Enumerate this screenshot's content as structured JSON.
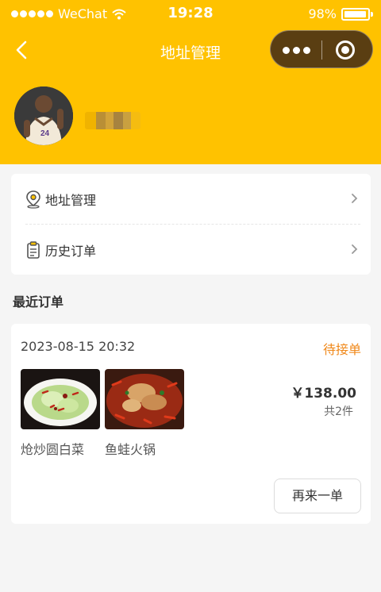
{
  "status_bar": {
    "carrier": "WeChat",
    "time": "19:28",
    "battery_percent": "98%",
    "battery_level": 0.98
  },
  "nav": {
    "title": "地址管理",
    "back_icon": "chevron-left-icon",
    "capsule_more_icon": "more-dots-icon",
    "capsule_close_icon": "target-close-icon"
  },
  "colors": {
    "header_bg": "#ffc200",
    "status_accent": "#f0881a",
    "page_bg": "#f5f5f5"
  },
  "menu": {
    "items": [
      {
        "label": "地址管理",
        "icon": "location-pin-icon"
      },
      {
        "label": "历史订单",
        "icon": "clipboard-icon"
      }
    ]
  },
  "recent_orders": {
    "title": "最近订单",
    "order": {
      "time": "2023-08-15 20:32",
      "status": "待接单",
      "dishes": [
        {
          "name": "炝炒圆白菜"
        },
        {
          "name": "鱼蛙火锅"
        }
      ],
      "price": "￥138.00",
      "count": "共2件",
      "reorder_label": "再来一单"
    }
  }
}
